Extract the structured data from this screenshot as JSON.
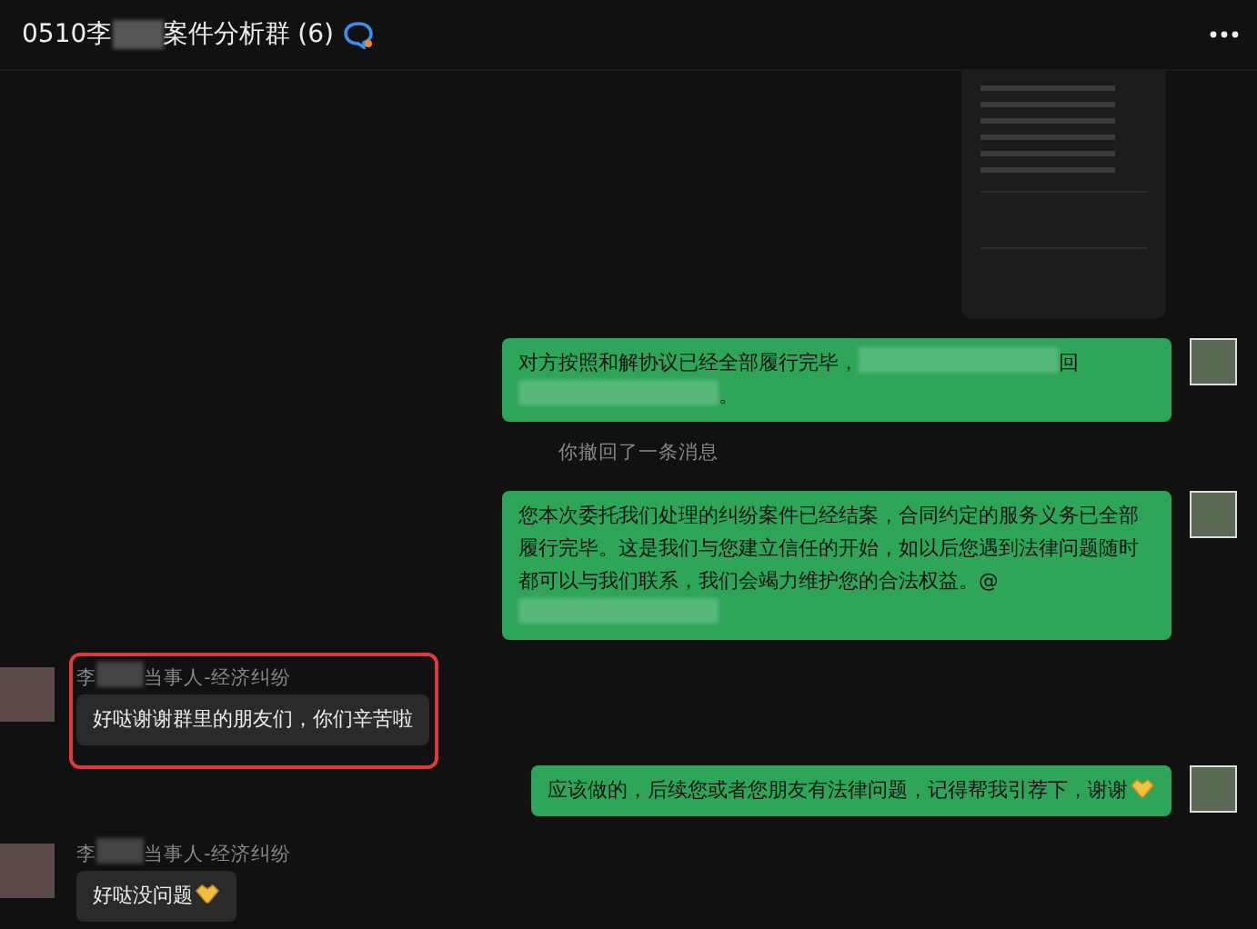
{
  "window": {
    "title_parts": [
      {
        "kind": "text",
        "text": "0510李"
      },
      {
        "kind": "redacted"
      },
      {
        "kind": "text",
        "text": "案件分析群"
      },
      {
        "kind": "text",
        "text": "(6)"
      }
    ]
  },
  "messages": [
    {
      "kind": "image",
      "outgoing": true
    },
    {
      "kind": "text",
      "outgoing": true,
      "highlighted": false,
      "parts": [
        {
          "kind": "text",
          "text": "对方按照和解协议已经全部履行完毕，"
        },
        {
          "kind": "redacted"
        },
        {
          "kind": "text",
          "text": "回"
        },
        {
          "kind": "redacted"
        },
        {
          "kind": "text",
          "text": "。"
        }
      ]
    },
    {
      "kind": "recall",
      "text": "你撤回了一条消息"
    },
    {
      "kind": "text",
      "outgoing": true,
      "highlighted": false,
      "parts": [
        {
          "kind": "text",
          "text": "您本次委托我们处理的纠纷案件已经结案，合同约定的服务义务已全部履行完毕。这是我们与您建立信任的开始，如以后您遇到法律问题随时都可以与我们联系，我们会竭力维护您的合法权益。@"
        },
        {
          "kind": "redacted"
        }
      ]
    },
    {
      "kind": "text",
      "outgoing": false,
      "highlighted": true,
      "sender_parts": [
        {
          "kind": "text",
          "text": "李"
        },
        {
          "kind": "redacted"
        },
        {
          "kind": "text",
          "text": "当事人-经济纠纷"
        }
      ],
      "parts": [
        {
          "kind": "text",
          "text": "好哒谢谢群里的朋友们，你们辛苦啦"
        }
      ]
    },
    {
      "kind": "text",
      "outgoing": true,
      "highlighted": false,
      "parts": [
        {
          "kind": "text",
          "text": "应该做的，后续您或者您朋友有法律问题，记得帮我引荐下，谢谢"
        },
        {
          "kind": "emoji"
        }
      ]
    },
    {
      "kind": "text",
      "outgoing": false,
      "highlighted": false,
      "sender_parts": [
        {
          "kind": "text",
          "text": "李"
        },
        {
          "kind": "redacted"
        },
        {
          "kind": "text",
          "text": "当事人-经济纠纷"
        }
      ],
      "parts": [
        {
          "kind": "text",
          "text": "好哒没问题"
        },
        {
          "kind": "emoji"
        }
      ]
    }
  ]
}
